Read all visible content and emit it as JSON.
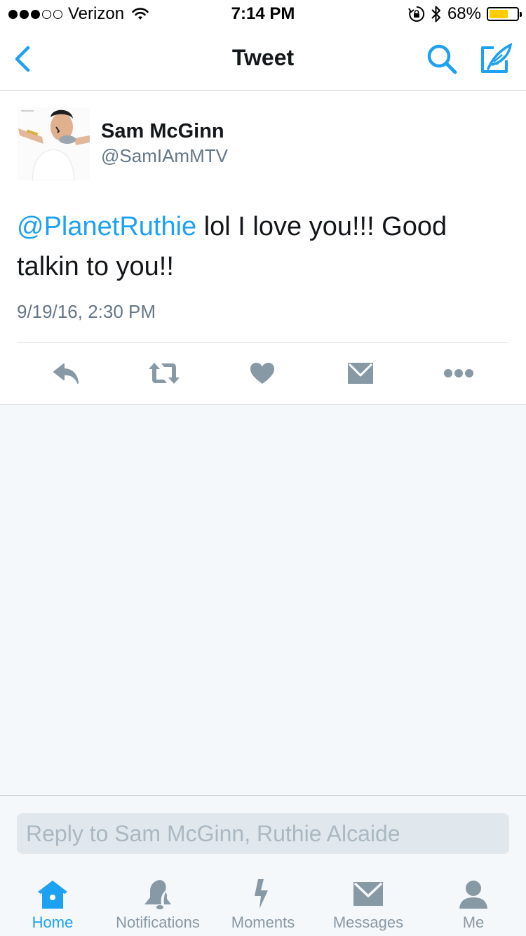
{
  "status_bar": {
    "carrier": "Verizon",
    "time": "7:14 PM",
    "battery_percent": "68%",
    "battery_level": 0.68,
    "signal_bars": 3,
    "signal_total": 5
  },
  "nav": {
    "title": "Tweet"
  },
  "tweet": {
    "display_name": "Sam McGinn",
    "screen_name": "@SamIAmMTV",
    "mention": "@PlanetRuthie",
    "text": " lol I love you!!! Good talkin to you!!",
    "timestamp": "9/19/16, 2:30 PM"
  },
  "reply": {
    "placeholder": "Reply to Sam McGinn, Ruthie Alcaide"
  },
  "tabs": [
    {
      "label": "Home",
      "icon": "home-icon",
      "active": true
    },
    {
      "label": "Notifications",
      "icon": "bell-icon",
      "active": false
    },
    {
      "label": "Moments",
      "icon": "lightning-icon",
      "active": false
    },
    {
      "label": "Messages",
      "icon": "envelope-icon",
      "active": false
    },
    {
      "label": "Me",
      "icon": "person-icon",
      "active": false
    }
  ],
  "colors": {
    "accent": "#1da1f2",
    "text": "#14171a",
    "secondary_text": "#657786",
    "icon_gray": "#8899a6",
    "background": "#f5f8fa",
    "battery": "#ffcc00"
  }
}
